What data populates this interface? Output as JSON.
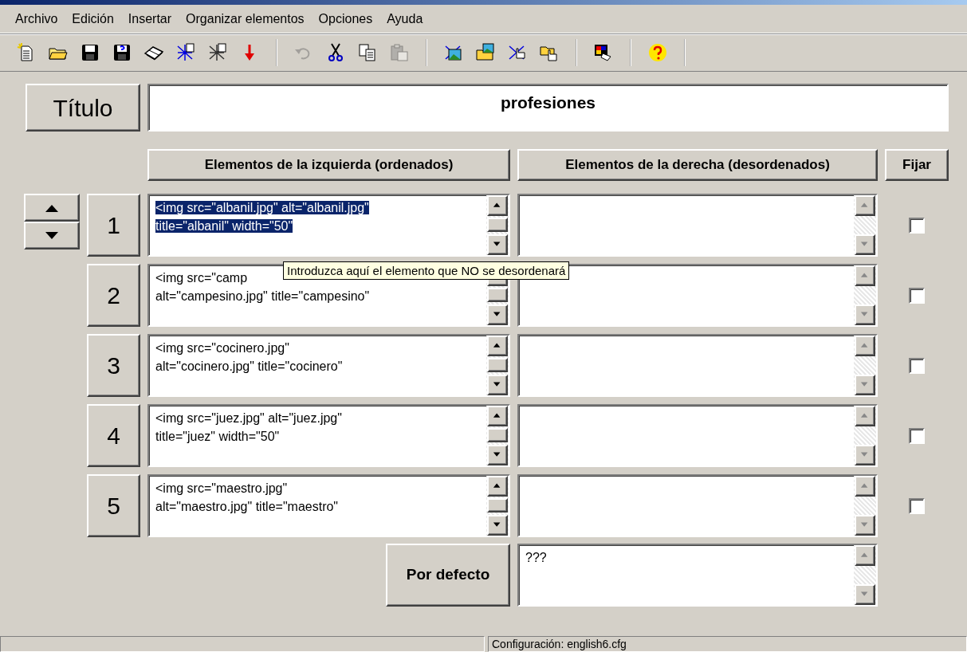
{
  "menu": [
    "Archivo",
    "Edición",
    "Insertar",
    "Organizar elementos",
    "Opciones",
    "Ayuda"
  ],
  "toolbar": [
    [
      {
        "disabled": false
      },
      {
        "disabled": false
      },
      {
        "disabled": false
      },
      {
        "disabled": false
      },
      {
        "disabled": false
      },
      {
        "disabled": false
      },
      {
        "disabled": false
      },
      {
        "disabled": false
      }
    ],
    [
      {
        "disabled": true
      },
      {
        "disabled": false
      },
      {
        "disabled": false
      },
      {
        "disabled": true
      }
    ],
    [
      {
        "disabled": false
      },
      {
        "disabled": false
      },
      {
        "disabled": false
      },
      {
        "disabled": false
      }
    ],
    [
      {
        "disabled": false
      }
    ],
    [
      {
        "disabled": false
      }
    ]
  ],
  "title": {
    "button": "Título",
    "value": "profesiones"
  },
  "headers": {
    "left": "Elementos de la izquierda (ordenados)",
    "right": "Elementos de la derecha (desordenados)",
    "fixed": "Fijar"
  },
  "rows": [
    {
      "number": "1",
      "left": [
        "<img src=\"albanil.jpg\" alt=\"albanil.jpg\"",
        "title=\"albanil\" width=\"50\""
      ],
      "text_selected": true,
      "fixed": false
    },
    {
      "number": "2",
      "left": [
        "<img src=\"camp",
        "alt=\"campesino.jpg\" title=\"campesino\""
      ],
      "text_selected": false,
      "fixed": false
    },
    {
      "number": "3",
      "left": [
        "<img src=\"cocinero.jpg\"",
        "alt=\"cocinero.jpg\" title=\"cocinero\""
      ],
      "text_selected": false,
      "fixed": false
    },
    {
      "number": "4",
      "left": [
        "<img src=\"juez.jpg\" alt=\"juez.jpg\"",
        "title=\"juez\" width=\"50\""
      ],
      "text_selected": false,
      "fixed": false
    },
    {
      "number": "5",
      "left": [
        "<img src=\"maestro.jpg\"",
        "alt=\"maestro.jpg\" title=\"maestro\""
      ],
      "text_selected": false,
      "fixed": false
    }
  ],
  "default": {
    "button": "Por defecto",
    "value": "???"
  },
  "tooltip": "Introduzca aquí el elemento que NO se desordenará",
  "status_bar": {
    "text": "Configuración: english6.cfg"
  }
}
